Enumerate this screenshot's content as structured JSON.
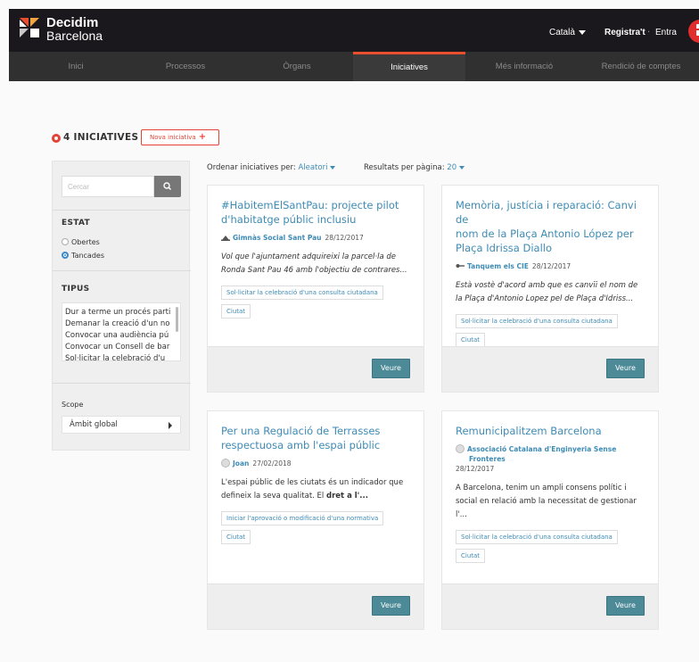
{
  "header": {
    "brand_line1": "Decidim",
    "brand_line2": "Barcelona",
    "language": "Català",
    "register": "Registra't",
    "separator": "·",
    "login": "Entra",
    "accent_color": "#e02d2d"
  },
  "nav": {
    "items": [
      {
        "label": "Inici"
      },
      {
        "label": "Processos"
      },
      {
        "label": "Òrgans"
      },
      {
        "label": "Iniciatives"
      },
      {
        "label": "Més informació"
      },
      {
        "label": "Rendició de comptes"
      }
    ],
    "active": "Iniciatives"
  },
  "page": {
    "title": "4 INICIATIVES",
    "new_button": "Nova iniciativa",
    "new_button_icon": "+"
  },
  "sidebar": {
    "search_placeholder": "Cercar",
    "search_icon": "search-icon",
    "estat_heading": "ESTAT",
    "estat_options": [
      {
        "label": "Obertes",
        "selected": false
      },
      {
        "label": "Tancades",
        "selected": true
      }
    ],
    "tipus_heading": "TIPUS",
    "tipus_options": [
      "Dur a terme un procés parti",
      "Demanar la creació d'un no",
      "Convocar una audiència pú",
      "Convocar un Consell de bar",
      "Sol·licitar la celebració d'u"
    ],
    "scope_label": "Scope",
    "scope_value": "Àmbit global"
  },
  "toolbar": {
    "order_label": "Ordenar iniciatives per:",
    "order_value": "Aleatori",
    "perpage_label": "Resultats per pàgina:",
    "perpage_value": "20"
  },
  "cards": [
    {
      "title_lines": [
        "#HabitemElSantPau: projecte pilot",
        "d'habitatge públic inclusiu"
      ],
      "author": "Gimnàs Social Sant Pau",
      "author_icon": "group-icon",
      "date": "28/12/2017",
      "desc_lines": [
        "Vol que l'ajuntament adquireixi la parcel·la de",
        "Ronda Sant Pau 46 amb l'objectiu de contrares..."
      ],
      "tags": [
        "Sol·licitar la celebració d'una consulta ciutadana",
        "Ciutat"
      ],
      "button": "Veure"
    },
    {
      "title_lines": [
        "Memòria, justícia i reparació: Canvi de",
        "nom de la Plaça Antonio López per",
        "Plaça Idrissa Diallo"
      ],
      "author": "Tanquem els CIE",
      "author_icon": "key-icon",
      "date": "28/12/2017",
      "desc_lines": [
        "Està vostè d'acord amb que es canvïi el nom de",
        "la Plaça d'Antonio Lopez pel de Plaça d'Idriss..."
      ],
      "tags": [
        "Sol·licitar la celebració d'una consulta ciutadana",
        "Ciutat"
      ],
      "button": "Veure"
    },
    {
      "title_lines": [
        "Per una Regulació de Terrasses",
        "respectuosa amb l'espai públic"
      ],
      "author": "Joan",
      "author_icon": "avatar-icon",
      "date": "27/02/2018",
      "desc_lines": [
        "L'espai públic de les ciutats és un indicador que",
        "defineix la seva qualitat. El "
      ],
      "desc_bold": "dret a l'...",
      "tags": [
        "Iniciar l'aprovació o modificació d'una normativa",
        "Ciutat"
      ],
      "button": "Veure"
    },
    {
      "title_lines": [
        "Remunicipalitzem Barcelona"
      ],
      "author_lines": [
        "Associació Catalana d'Enginyeria Sense",
        "Fronteres"
      ],
      "author_icon": "avatar-icon",
      "date": "28/12/2017",
      "desc_lines": [
        "A Barcelona, tenim un ampli consens polític i",
        "social en relació amb la necessitat de gestionar",
        "l'..."
      ],
      "tags": [
        "Sol·licitar la celebració d'una consulta ciutadana",
        "Ciutat"
      ],
      "button": "Veure"
    }
  ]
}
